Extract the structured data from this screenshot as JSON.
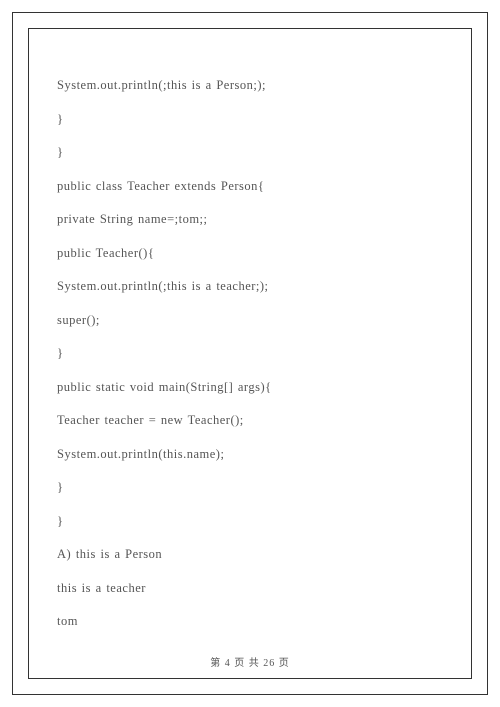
{
  "lines": [
    "System.out.println(;this is a Person;);",
    "}",
    "}",
    "public class Teacher extends Person{",
    "private String name=;tom;;",
    "public Teacher(){",
    "System.out.println(;this is a teacher;);",
    "super();",
    "}",
    "public static void main(String[] args){",
    "Teacher teacher = new Teacher();",
    "System.out.println(this.name);",
    "}",
    "}",
    "A) this is a Person",
    "this is a teacher",
    "tom"
  ],
  "footer": "第 4 页    共 26 页"
}
